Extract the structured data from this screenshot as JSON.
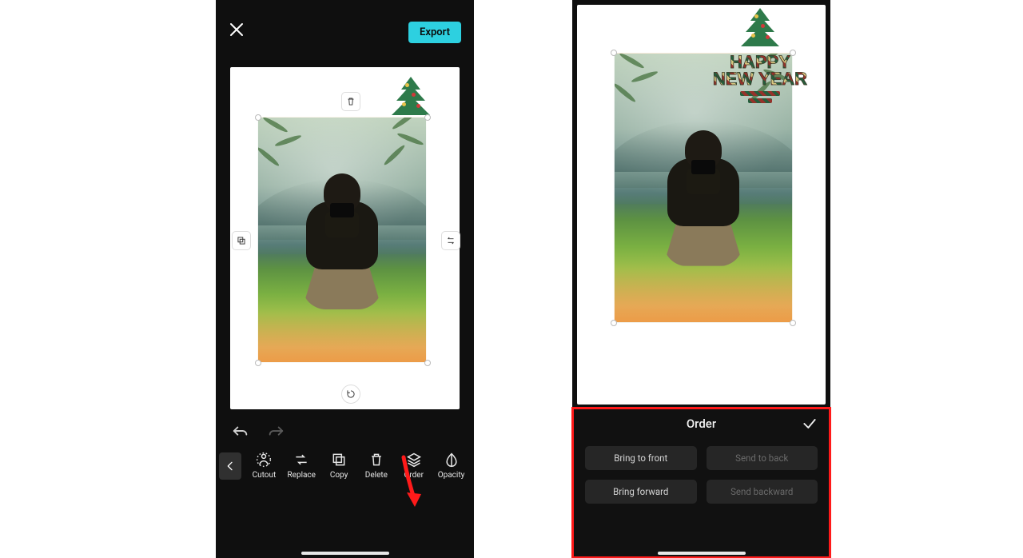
{
  "left": {
    "export_label": "Export",
    "toolbar": {
      "items": [
        {
          "key": "cutout",
          "label": "Cutout"
        },
        {
          "key": "replace",
          "label": "Replace"
        },
        {
          "key": "copy",
          "label": "Copy"
        },
        {
          "key": "delete",
          "label": "Delete"
        },
        {
          "key": "order",
          "label": "Order"
        },
        {
          "key": "opacity",
          "label": "Opacity"
        }
      ]
    }
  },
  "right": {
    "sticker": {
      "line1": "HAPPY",
      "line2": "NEW YEAR"
    },
    "order_panel": {
      "title": "Order",
      "buttons": {
        "bring_front": "Bring to front",
        "send_back": "Send to back",
        "bring_forward": "Bring forward",
        "send_backward": "Send backward"
      }
    }
  }
}
